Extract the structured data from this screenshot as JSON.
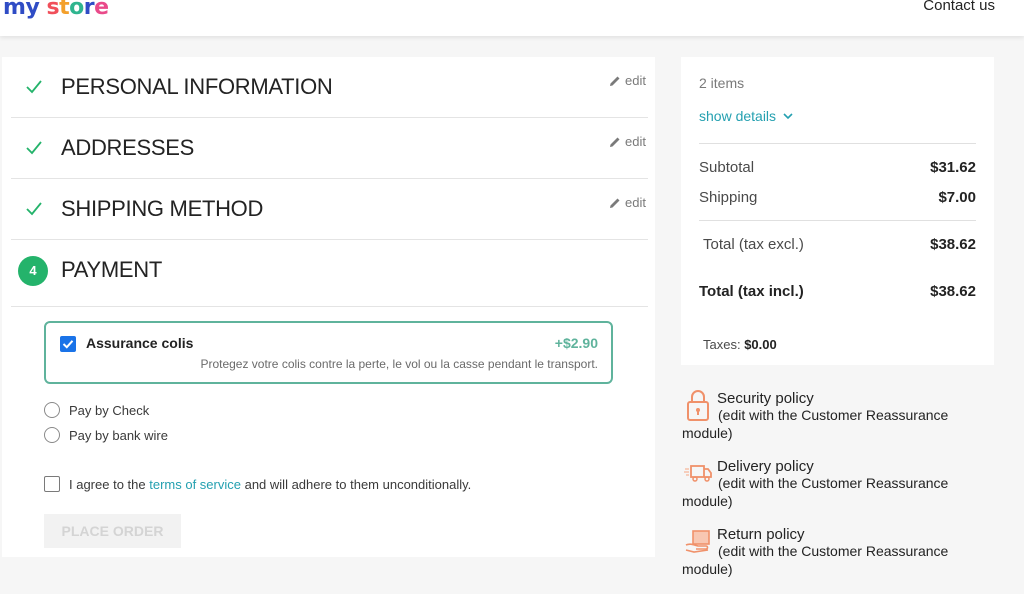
{
  "header": {
    "logo_letters": [
      "m",
      "y",
      " ",
      "s",
      "t",
      "o",
      "r",
      "e"
    ],
    "logo_colors": [
      "#2f4cc5",
      "#2f4cc5",
      "#2f4cc5",
      "#f04f5a",
      "#f3a02b",
      "#2fb58f",
      "#2f4cc5",
      "#e94a8a"
    ],
    "contact": "Contact us"
  },
  "steps": [
    {
      "title": "PERSONAL INFORMATION",
      "edit": "edit"
    },
    {
      "title": "ADDRESSES",
      "edit": "edit"
    },
    {
      "title": "SHIPPING METHOD",
      "edit": "edit"
    },
    {
      "number": "4",
      "title": "PAYMENT"
    }
  ],
  "payment": {
    "insurance_title": "Assurance colis",
    "insurance_price": "+$2.90",
    "insurance_desc": "Protegez votre colis contre la perte, le vol ou la casse pendant le transport.",
    "options": [
      "Pay by Check",
      "Pay by bank wire"
    ],
    "terms_before": "I agree to the ",
    "terms_link": "terms of service",
    "terms_after": " and will adhere to them unconditionally.",
    "place_order": "PLACE ORDER"
  },
  "summary": {
    "items": "2 items",
    "show_details": "show details",
    "subtotal_label": "Subtotal",
    "subtotal": "$31.62",
    "shipping_label": "Shipping",
    "shipping": "$7.00",
    "total_excl_label": "Total (tax excl.)",
    "total_excl": "$38.62",
    "total_incl_label": "Total (tax incl.)",
    "total_incl": "$38.62",
    "taxes_label": "Taxes: ",
    "taxes": "$0.00"
  },
  "reassurance": [
    {
      "title": "Security policy",
      "line2": "(edit with the Customer Reassurance",
      "line3": "module)",
      "icon": "lock-icon"
    },
    {
      "title": "Delivery policy",
      "line2": "(edit with the Customer Reassurance",
      "line3": "module)",
      "icon": "truck-icon"
    },
    {
      "title": "Return policy",
      "line2": "(edit with the Customer Reassurance",
      "line3": "module)",
      "icon": "return-box-icon"
    }
  ],
  "colors": {
    "accent": "#24a0b0",
    "success": "#24b36b",
    "insurance": "#5fb39c"
  }
}
